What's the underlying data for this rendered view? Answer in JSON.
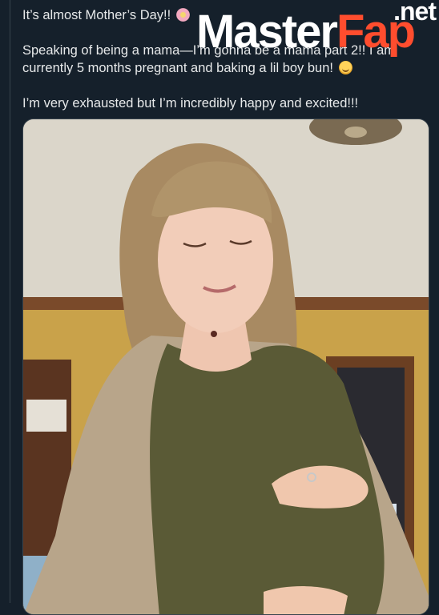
{
  "post": {
    "line1": "It’s almost Mother’s Day!!",
    "line2": "Speaking of being a mama—I’m gonna be a mama part 2!! I am currently 5 months pregnant and baking a lil boy bun!",
    "line3": "I’m very exhausted but I’m incredibly happy and excited!!!"
  },
  "watermark": {
    "main_a": "Master",
    "main_b": "Fap",
    "suffix": ".net"
  },
  "media": {
    "description_icon": "video-still"
  },
  "colors": {
    "background": "#15202b",
    "text": "#e7e9ea",
    "watermark_accent": "#ff4d2e"
  }
}
